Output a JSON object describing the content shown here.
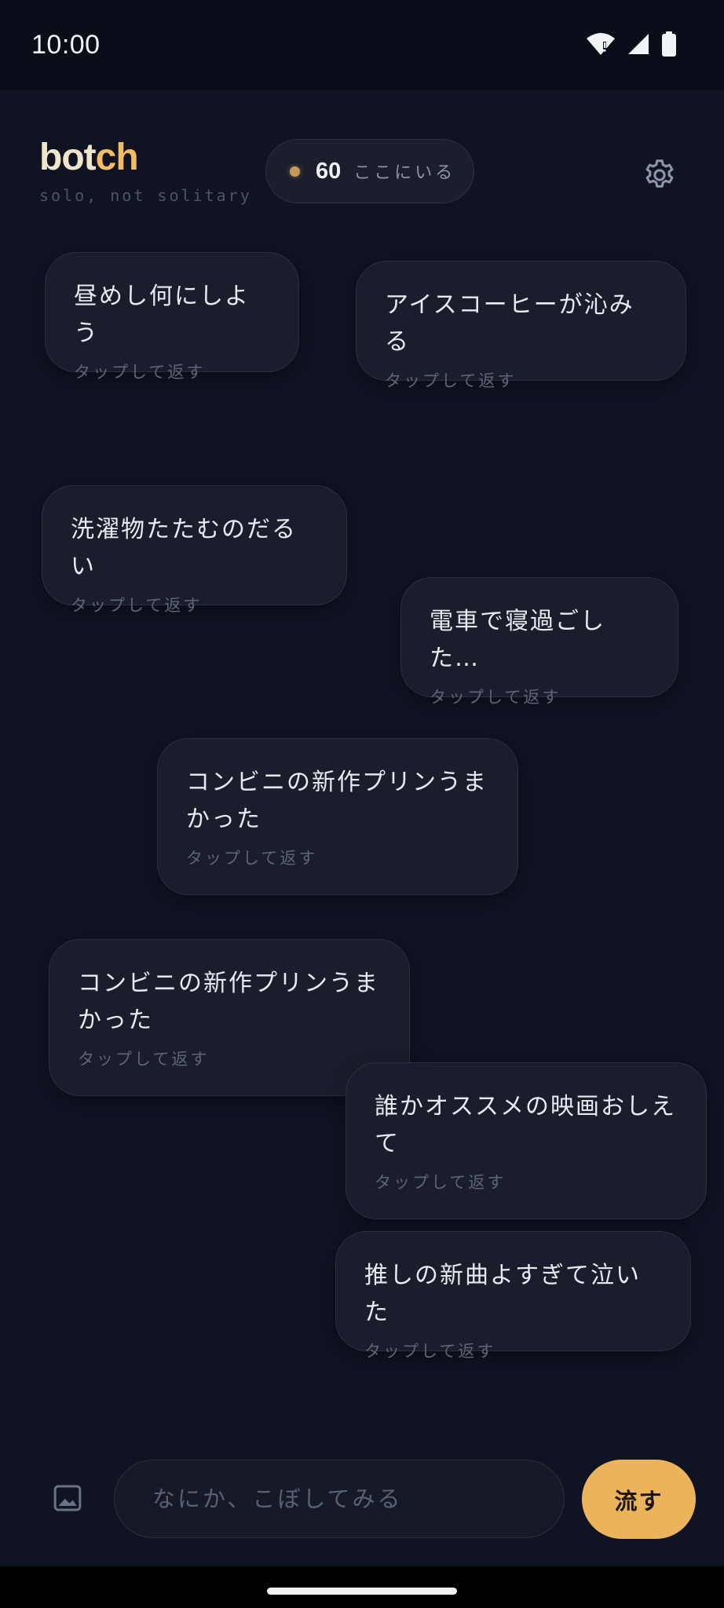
{
  "status_bar": {
    "time": "10:00",
    "icons": [
      "wifi-icon",
      "cell-signal-icon",
      "battery-icon"
    ]
  },
  "header": {
    "brand_part1": "bot",
    "brand_part2": "ch",
    "tagline": "solo, not solitary",
    "presence_count": "60",
    "presence_label": "ここにいる",
    "settings_icon": "gear-icon"
  },
  "posts": [
    {
      "text": "昼めし何にしよう",
      "hint": "タップして返す"
    },
    {
      "text": "アイスコーヒーが沁みる",
      "hint": "タップして返す"
    },
    {
      "text": "洗濯物たたむのだるい",
      "hint": "タップして返す"
    },
    {
      "text": "電車で寝過ごした…",
      "hint": "タップして返す"
    },
    {
      "text": "コンビニの新作プリンうま\nかった",
      "hint": "タップして返す"
    },
    {
      "text": "コンビニの新作プリンうま\nかった",
      "hint": "タップして返す"
    },
    {
      "text": "誰かオススメの映画おしえ\nて",
      "hint": "タップして返す"
    },
    {
      "text": "推しの新曲よすぎて泣いた",
      "hint": "タップして返す"
    }
  ],
  "composer": {
    "image_icon": "image-icon",
    "placeholder": "なにか、こぼしてみる",
    "value": "",
    "send_label": "流す"
  },
  "colors": {
    "background": "#0f1322",
    "accent": "#ebb45c",
    "card": "#1a1e2c",
    "presence_dot": "#c89a5b"
  }
}
